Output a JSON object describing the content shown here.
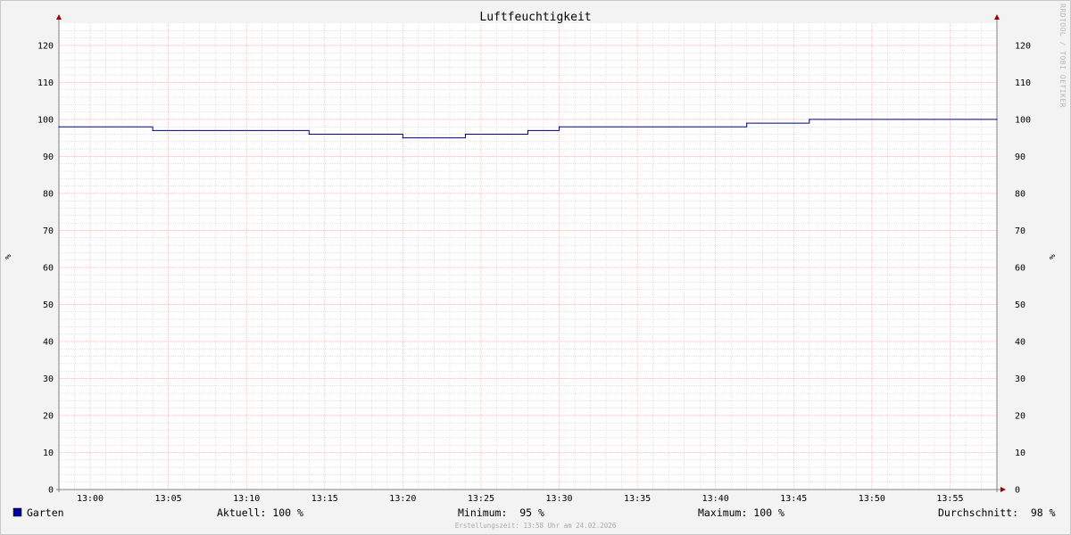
{
  "chart_data": {
    "type": "line",
    "title": "Luftfeuchtigkeit",
    "ylabel_left": "%",
    "ylabel_right": "%",
    "ylim": [
      0,
      126
    ],
    "y_ticks": [
      0,
      10,
      20,
      30,
      40,
      50,
      60,
      70,
      80,
      90,
      100,
      110,
      120
    ],
    "y_tick_labels": [
      "0",
      "10",
      "20",
      "30",
      "40",
      "50",
      "60",
      "70",
      "80",
      "90",
      "100",
      "110",
      "120"
    ],
    "x_range": [
      "12:58",
      "13:58"
    ],
    "x_ticks": [
      "13:00",
      "13:05",
      "13:10",
      "13:15",
      "13:20",
      "13:25",
      "13:30",
      "13:35",
      "13:40",
      "13:45",
      "13:50",
      "13:55"
    ],
    "grid": true,
    "step": true,
    "series": [
      {
        "name": "Garten",
        "color": "#000080",
        "points": [
          {
            "x": "12:58",
            "y": 98
          },
          {
            "x": "13:04",
            "y": 97
          },
          {
            "x": "13:14",
            "y": 96
          },
          {
            "x": "13:20",
            "y": 95
          },
          {
            "x": "13:24",
            "y": 96
          },
          {
            "x": "13:28",
            "y": 97
          },
          {
            "x": "13:30",
            "y": 98
          },
          {
            "x": "13:42",
            "y": 99
          },
          {
            "x": "13:46",
            "y": 100
          },
          {
            "x": "13:58",
            "y": 100
          }
        ]
      }
    ]
  },
  "legend": {
    "series_name": "Garten",
    "swatch_color": "#0000a0",
    "aktuell": "Aktuell: 100 %",
    "minimum": "Minimum:  95 %",
    "maximum": "Maximum: 100 %",
    "durchschnitt": "Durchschnitt:  98 %"
  },
  "watermark": "RRDTOOL / TOBI OETIKER",
  "footer": "Erstellungszeit: 13:58 Uhr am 24.02.2026",
  "colors": {
    "background": "#f3f3f3",
    "plot_background": "#ffffff",
    "major_grid": "#ff9c9c",
    "minor_grid": "#c8c8c8",
    "axis": "#808080",
    "arrow": "#a00000"
  }
}
